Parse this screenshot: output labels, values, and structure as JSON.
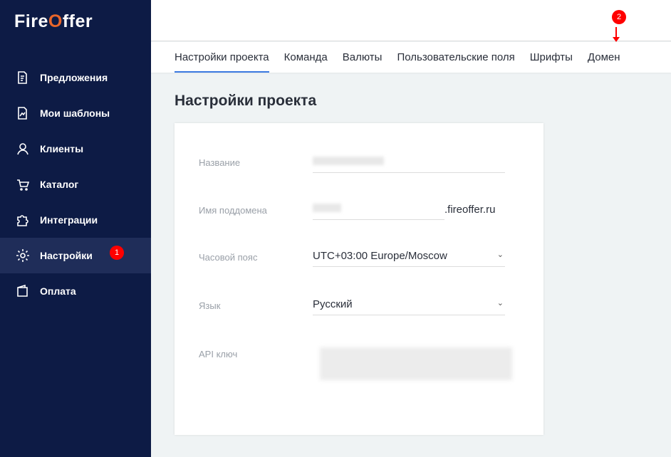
{
  "logo": {
    "text_a": "Fire",
    "text_b": "O",
    "text_c": "ffer"
  },
  "sidebar": {
    "items": [
      {
        "label": "Предложения"
      },
      {
        "label": "Мои шаблоны"
      },
      {
        "label": "Клиенты"
      },
      {
        "label": "Каталог"
      },
      {
        "label": "Интеграции"
      },
      {
        "label": "Настройки"
      },
      {
        "label": "Оплата"
      }
    ]
  },
  "badges": {
    "one": "1",
    "two": "2"
  },
  "tabs": [
    {
      "label": "Настройки проекта"
    },
    {
      "label": "Команда"
    },
    {
      "label": "Валюты"
    },
    {
      "label": "Пользовательские поля"
    },
    {
      "label": "Шрифты"
    },
    {
      "label": "Домен"
    }
  ],
  "page_title": "Настройки проекта",
  "form": {
    "name_label": "Название",
    "subdomain_label": "Имя поддомена",
    "subdomain_suffix": ".fireoffer.ru",
    "timezone_label": "Часовой пояс",
    "timezone_value": "UTC+03:00 Europe/Moscow",
    "language_label": "Язык",
    "language_value": "Русский",
    "api_label": "API ключ"
  }
}
